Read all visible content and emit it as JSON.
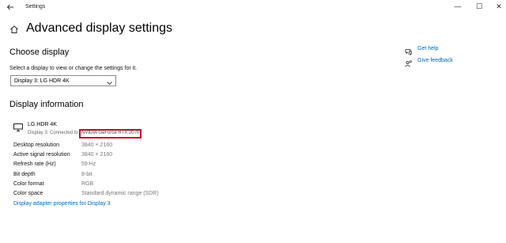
{
  "window": {
    "title": "Settings",
    "back_icon": "back-arrow-icon",
    "minimize_glyph": "—",
    "maximize_glyph": "☐",
    "close_glyph": "✕"
  },
  "page": {
    "title": "Advanced display settings",
    "home_icon": "home-icon"
  },
  "choose_display": {
    "heading": "Choose display",
    "instruction": "Select a display to view or change the settings for it.",
    "selected_display": "Display 3: LG HDR 4K"
  },
  "display_information": {
    "heading": "Display information",
    "monitor_name": "LG HDR 4K",
    "connection_prefix": "Display 3: Connected to",
    "gpu": "NVIDIA GeForce RTX 2070",
    "rows": [
      {
        "label": "Desktop resolution",
        "value": "3840 × 2160"
      },
      {
        "label": "Active signal resolution",
        "value": "3840 × 2160"
      },
      {
        "label": "Refresh rate (Hz)",
        "value": "59 Hz"
      },
      {
        "label": "Bit depth",
        "value": "8-bit"
      },
      {
        "label": "Color format",
        "value": "RGB"
      },
      {
        "label": "Color space",
        "value": "Standard dynamic range (SDR)"
      }
    ],
    "adapter_link": "Display adapter properties for Display 3"
  },
  "side_links": {
    "get_help": "Get help",
    "give_feedback": "Give feedback"
  },
  "colors": {
    "link": "#0067b8",
    "highlight_border": "#c8102e"
  }
}
